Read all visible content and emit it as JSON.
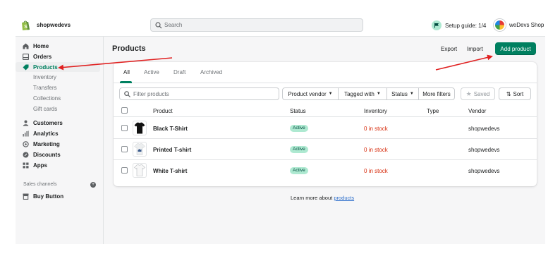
{
  "topbar": {
    "store_name": "shopwedevs",
    "search_placeholder": "Search",
    "setup_guide": "Setup guide: 1/4",
    "shop_label": "weDevs Shop"
  },
  "sidebar": {
    "items": [
      {
        "label": "Home",
        "icon": "home-icon"
      },
      {
        "label": "Orders",
        "icon": "orders-icon"
      },
      {
        "label": "Products",
        "icon": "tag-icon",
        "active": true
      },
      {
        "label": "Customers",
        "icon": "person-icon"
      },
      {
        "label": "Analytics",
        "icon": "bar-chart-icon"
      },
      {
        "label": "Marketing",
        "icon": "target-icon"
      },
      {
        "label": "Discounts",
        "icon": "discount-icon"
      },
      {
        "label": "Apps",
        "icon": "apps-icon"
      }
    ],
    "product_subitems": [
      "Inventory",
      "Transfers",
      "Collections",
      "Gift cards"
    ],
    "channels_title": "Sales channels",
    "channels": [
      {
        "label": "Buy Button",
        "icon": "store-icon"
      }
    ]
  },
  "header": {
    "title": "Products",
    "export_label": "Export",
    "import_label": "Import",
    "add_label": "Add product"
  },
  "tabs": [
    "All",
    "Active",
    "Draft",
    "Archived"
  ],
  "filters": {
    "placeholder": "Filter products",
    "product_vendor": "Product vendor",
    "tagged_with": "Tagged with",
    "status": "Status",
    "more_filters": "More filters",
    "saved": "Saved",
    "sort": "Sort"
  },
  "table": {
    "columns": [
      "Product",
      "Status",
      "Inventory",
      "Type",
      "Vendor"
    ],
    "rows": [
      {
        "product": "Black T-Shirt",
        "status": "Active",
        "inventory": "0 in stock",
        "type": "",
        "vendor": "shopwedevs"
      },
      {
        "product": "Printed T-shirt",
        "status": "Active",
        "inventory": "0 in stock",
        "type": "",
        "vendor": "shopwedevs"
      },
      {
        "product": "White T-shirt",
        "status": "Active",
        "inventory": "0 in stock",
        "type": "",
        "vendor": "shopwedevs"
      }
    ]
  },
  "footer": {
    "learn_prefix": "Learn more about",
    "learn_link": "products"
  },
  "colors": {
    "accent": "#008060",
    "status_badge": "#aee9d1",
    "stock_warning": "#d72c0d",
    "annotation_arrow": "#e02020"
  }
}
